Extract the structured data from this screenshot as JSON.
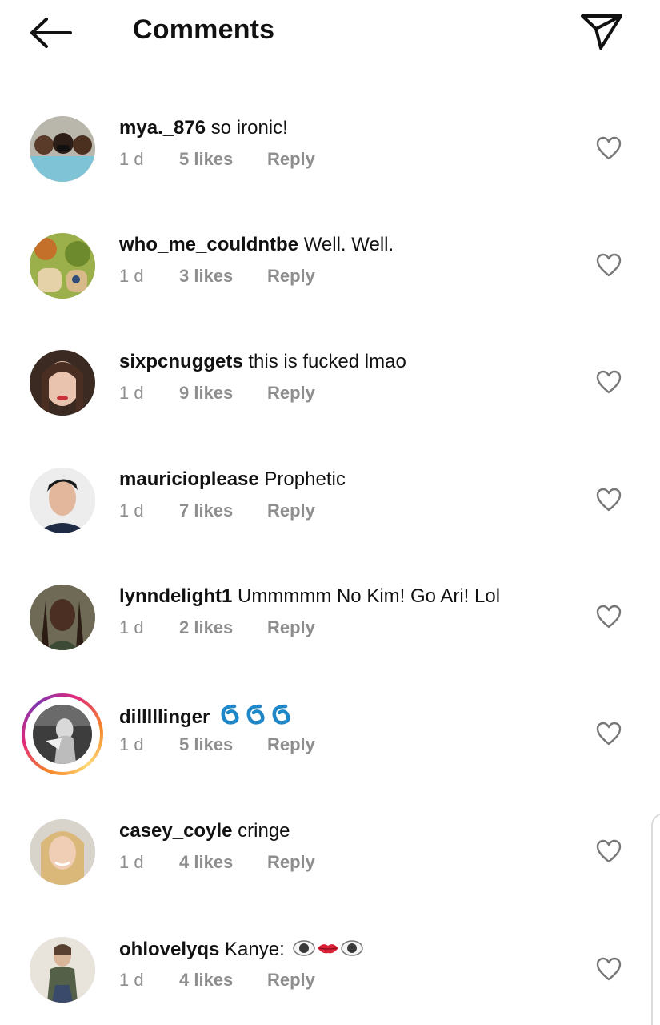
{
  "header": {
    "title": "Comments",
    "back_icon": "arrow-left-icon",
    "send_icon": "paper-plane-icon"
  },
  "colors": {
    "text": "#111111",
    "meta": "#8e8e8e",
    "cyclone": "#1e88c8"
  },
  "comments": [
    {
      "username": "mya._876",
      "text": "so ironic!",
      "time": "1 d",
      "likes": "5 likes",
      "reply": "Reply"
    },
    {
      "username": "who_me_couldntbe",
      "text": "Well. Well.",
      "time": "1 d",
      "likes": "3 likes",
      "reply": "Reply"
    },
    {
      "username": "sixpcnuggets",
      "text": "this is fucked lmao",
      "time": "1 d",
      "likes": "9 likes",
      "reply": "Reply"
    },
    {
      "username": "mauricioplease",
      "text": "Prophetic",
      "time": "1 d",
      "likes": "7 likes",
      "reply": "Reply"
    },
    {
      "username": "lynndelight1",
      "text": "Ummmmm No Kim! Go Ari! Lol",
      "time": "1 d",
      "likes": "2 likes",
      "reply": "Reply"
    },
    {
      "username": "dilllllinger",
      "text": "",
      "emoji": "cyclone-emoji x3",
      "time": "1 d",
      "likes": "5 likes",
      "reply": "Reply",
      "has_story": true
    },
    {
      "username": "casey_coyle",
      "text": "cringe",
      "time": "1 d",
      "likes": "4 likes",
      "reply": "Reply"
    },
    {
      "username": "ohlovelyqs",
      "text": "Kanye:",
      "emoji": "eye-lips-eye-emoji",
      "time": "1 d",
      "likes": "4 likes",
      "reply": "Reply"
    }
  ]
}
